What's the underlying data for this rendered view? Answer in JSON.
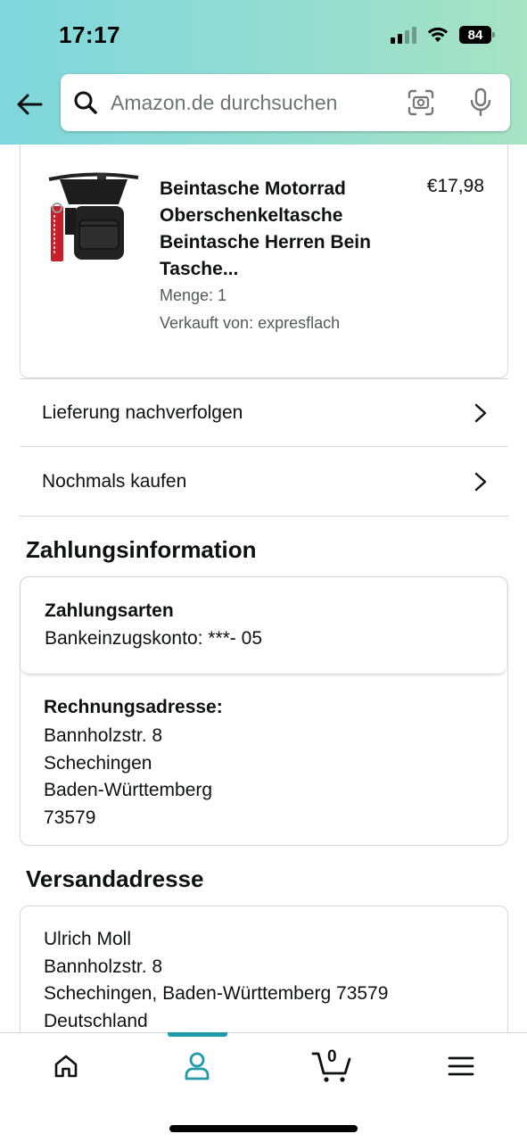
{
  "status_bar": {
    "time": "17:17",
    "battery": "84"
  },
  "search": {
    "placeholder": "Amazon.de durchsuchen"
  },
  "product": {
    "title": "Beintasche Motorrad Oberschenkeltasche Beintasche Herren Bein Tasche...",
    "price": "€17,98",
    "quantity": "Menge: 1",
    "seller": "Verkauft von: expresflach"
  },
  "actions": {
    "track_label": "Lieferung nachverfolgen",
    "buy_again_label": "Nochmals kaufen"
  },
  "payment": {
    "heading": "Zahlungsinformation",
    "methods_label": "Zahlungsarten",
    "methods_value": "Bankeinzugskonto: ***- 05",
    "billing_label": "Rechnungsadresse:",
    "billing_street": "Bannholzstr. 8",
    "billing_city": "Schechingen",
    "billing_state": "Baden-Württemberg",
    "billing_zip": "73579"
  },
  "shipping": {
    "heading": "Versandadresse",
    "name": "Ulrich Moll",
    "street": "Bannholzstr. 8",
    "city_line": "Schechingen, Baden-Württemberg 73579",
    "country": "Deutschland"
  },
  "bottom_nav": {
    "items": [
      "home-icon",
      "account-icon",
      "cart-icon",
      "menu-icon"
    ],
    "active": "account-icon",
    "cart_count": "0",
    "accent_color": "#1f9aa8"
  }
}
